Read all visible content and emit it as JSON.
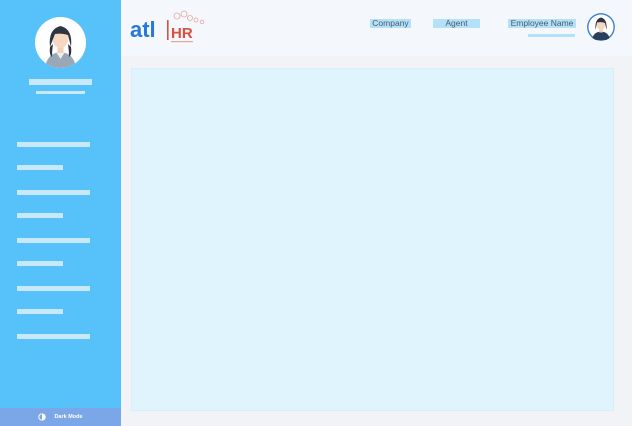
{
  "header": {
    "nav_links": [
      "Company",
      "Agent"
    ],
    "employee_name": "Employee Name"
  },
  "logo": {
    "brand_left": "atl",
    "brand_right": "HR"
  },
  "sidebar": {
    "dark_mode_label": "Dark Mode"
  },
  "colors": {
    "sidebar_bg": "#57c1fa",
    "header_bg": "#f4f7fc",
    "content_bg": "#e0f4fe",
    "logo_blue": "#2679d8",
    "logo_red": "#d9503f",
    "dark_mode_bg": "#7ba6e8"
  },
  "icons": {
    "dark_mode": "half-moon-icon",
    "profile": "female-avatar-icon",
    "header_profile": "female-avatar-icon"
  }
}
